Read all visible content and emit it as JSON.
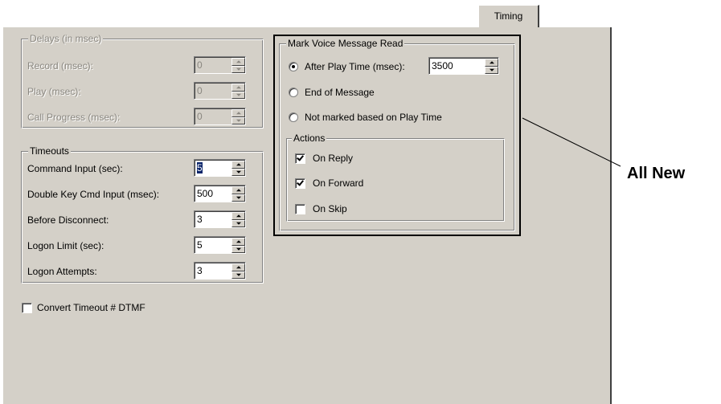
{
  "tab": {
    "label": "Timing"
  },
  "delays": {
    "legend": "Delays (in msec)",
    "rows": [
      {
        "label": "Record (msec):",
        "value": "0"
      },
      {
        "label": "Play (msec):",
        "value": "0"
      },
      {
        "label": "Call Progress (msec):",
        "value": "0"
      }
    ]
  },
  "timeouts": {
    "legend": "Timeouts",
    "rows": [
      {
        "label": "Command Input (sec):",
        "value": "5"
      },
      {
        "label": "Double Key Cmd Input (msec):",
        "value": "500"
      },
      {
        "label": "Before Disconnect:",
        "value": "3"
      },
      {
        "label": "Logon Limit (sec):",
        "value": "5"
      },
      {
        "label": "Logon Attempts:",
        "value": "3"
      }
    ]
  },
  "convert_timeout": {
    "label": "Convert Timeout # DTMF",
    "checked": false
  },
  "mark_read": {
    "legend": "Mark Voice Message Read",
    "options": [
      {
        "label": "After Play Time (msec):",
        "selected": true,
        "value": "3500"
      },
      {
        "label": "End of Message",
        "selected": false
      },
      {
        "label": "Not marked based on Play Time",
        "selected": false
      }
    ]
  },
  "actions": {
    "legend": "Actions",
    "items": [
      {
        "label": "On Reply",
        "checked": true
      },
      {
        "label": "On Forward",
        "checked": true
      },
      {
        "label": "On Skip",
        "checked": false
      }
    ]
  },
  "callout": {
    "text": "All New"
  },
  "colors": {
    "dialog_face": "#d4d0c8",
    "disabled_text": "#8a8780",
    "selection": "#0a246a"
  }
}
